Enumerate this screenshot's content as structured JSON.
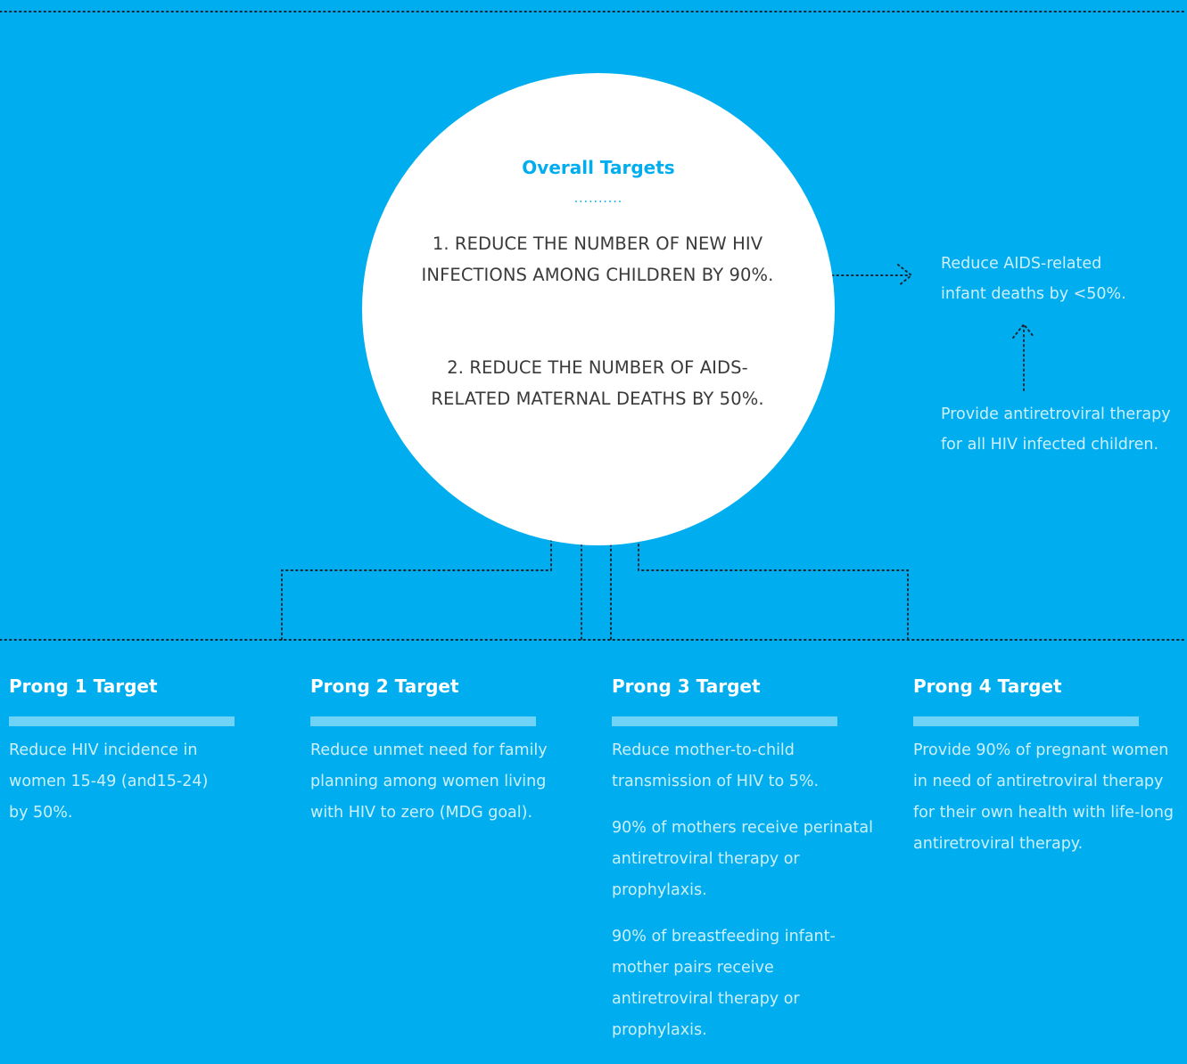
{
  "overall": {
    "title": "Overall Targets",
    "dots": "..........",
    "target_1": "1. REDUCE THE NUMBER OF NEW HIV INFECTIONS AMONG CHILDREN BY 90%.",
    "target_2": "2. REDUCE THE NUMBER OF AIDS-RELATED MATERNAL DEATHS BY 50%."
  },
  "side": {
    "infant_deaths_line1": "Reduce AIDS-related",
    "infant_deaths_line2": "infant deaths by <50%.",
    "art_children_line1": "Provide antiretroviral therapy",
    "art_children_line2": "for all HIV infected children."
  },
  "prongs": [
    {
      "title": "Prong 1 Target",
      "paragraphs": [
        "Reduce HIV incidence in women 15-49 (and15-24) by 50%."
      ]
    },
    {
      "title": "Prong 2 Target",
      "paragraphs": [
        "Reduce unmet need for family planning among women living with HIV to zero (MDG goal)."
      ]
    },
    {
      "title": "Prong 3 Target",
      "paragraphs": [
        "Reduce mother-to-child transmission of HIV to 5%.",
        "90% of mothers receive perinatal antiretroviral therapy or prophylaxis.",
        "90% of breastfeeding infant-mother pairs receive antiretroviral therapy or prophylaxis."
      ]
    },
    {
      "title": "Prong 4 Target",
      "paragraphs": [
        "Provide 90% of pregnant women in need of antiretroviral therapy for their own health with life-long antiretroviral therapy."
      ]
    }
  ],
  "colors": {
    "background": "#00aeef",
    "circle": "#ffffff",
    "accent": "#00aeef",
    "bar": "#6fd3f7",
    "light_text": "#cdeffc",
    "dark_text": "#3a3a3a",
    "dotted_line": "#1b2b3a"
  }
}
